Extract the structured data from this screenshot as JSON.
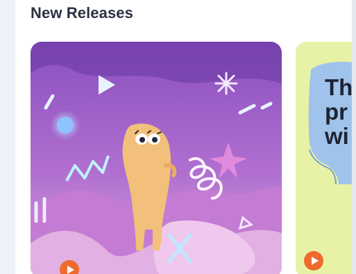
{
  "section": {
    "title": "New Releases"
  },
  "cards": [
    {
      "artwork_icon": "purple-creature-illustration",
      "play_icon": "play-icon",
      "accent_color": "#ef6a2c"
    },
    {
      "partial_text": "Th\npr\nwi",
      "artwork_icon": "blue-head-silhouette-illustration",
      "play_icon": "play-icon",
      "background_color": "#e8f2a6"
    }
  ]
}
